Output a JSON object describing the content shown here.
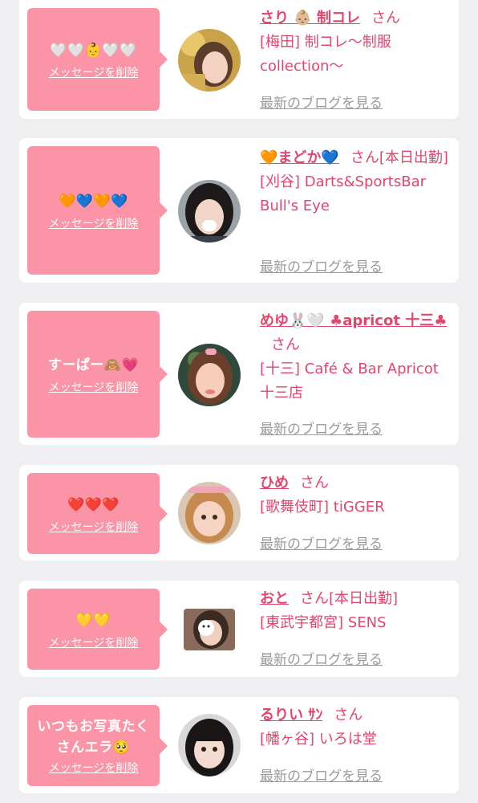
{
  "ui": {
    "delete_label": "メッセージを削除",
    "blog_label": "最新のブログを見る"
  },
  "cards": [
    {
      "message": "🤍🤍👶🤍🤍",
      "name": "さり 👶🏼 制コレ",
      "suffix": "さん",
      "shop": "[梅田] 制コレ〜制服collection〜"
    },
    {
      "message": "🧡💙🧡💙",
      "name": "🧡まどか💙",
      "suffix": "さん[本日出勤]",
      "shop": "[刈谷] Darts&SportsBar Bull's Eye"
    },
    {
      "message": "すーぱー🙈💗",
      "name": "めゆ🐰🤍 ♣apricot 十三♣",
      "suffix": "さん",
      "shop": "[十三] Café & Bar Apricot 十三店"
    },
    {
      "message": "❤️❤️❤️",
      "name": "ひめ",
      "suffix": "さん",
      "shop": "[歌舞伎町] tiGGER"
    },
    {
      "message": "💛💛",
      "name": "おと",
      "suffix": "さん[本日出勤]",
      "shop": "[東武宇都宮] SENS"
    },
    {
      "message": "いつもお写真たくさんエラ🥺",
      "name": "るりい ｻﾝ",
      "suffix": "さん",
      "shop": "[幡ヶ谷] いろは堂"
    }
  ]
}
